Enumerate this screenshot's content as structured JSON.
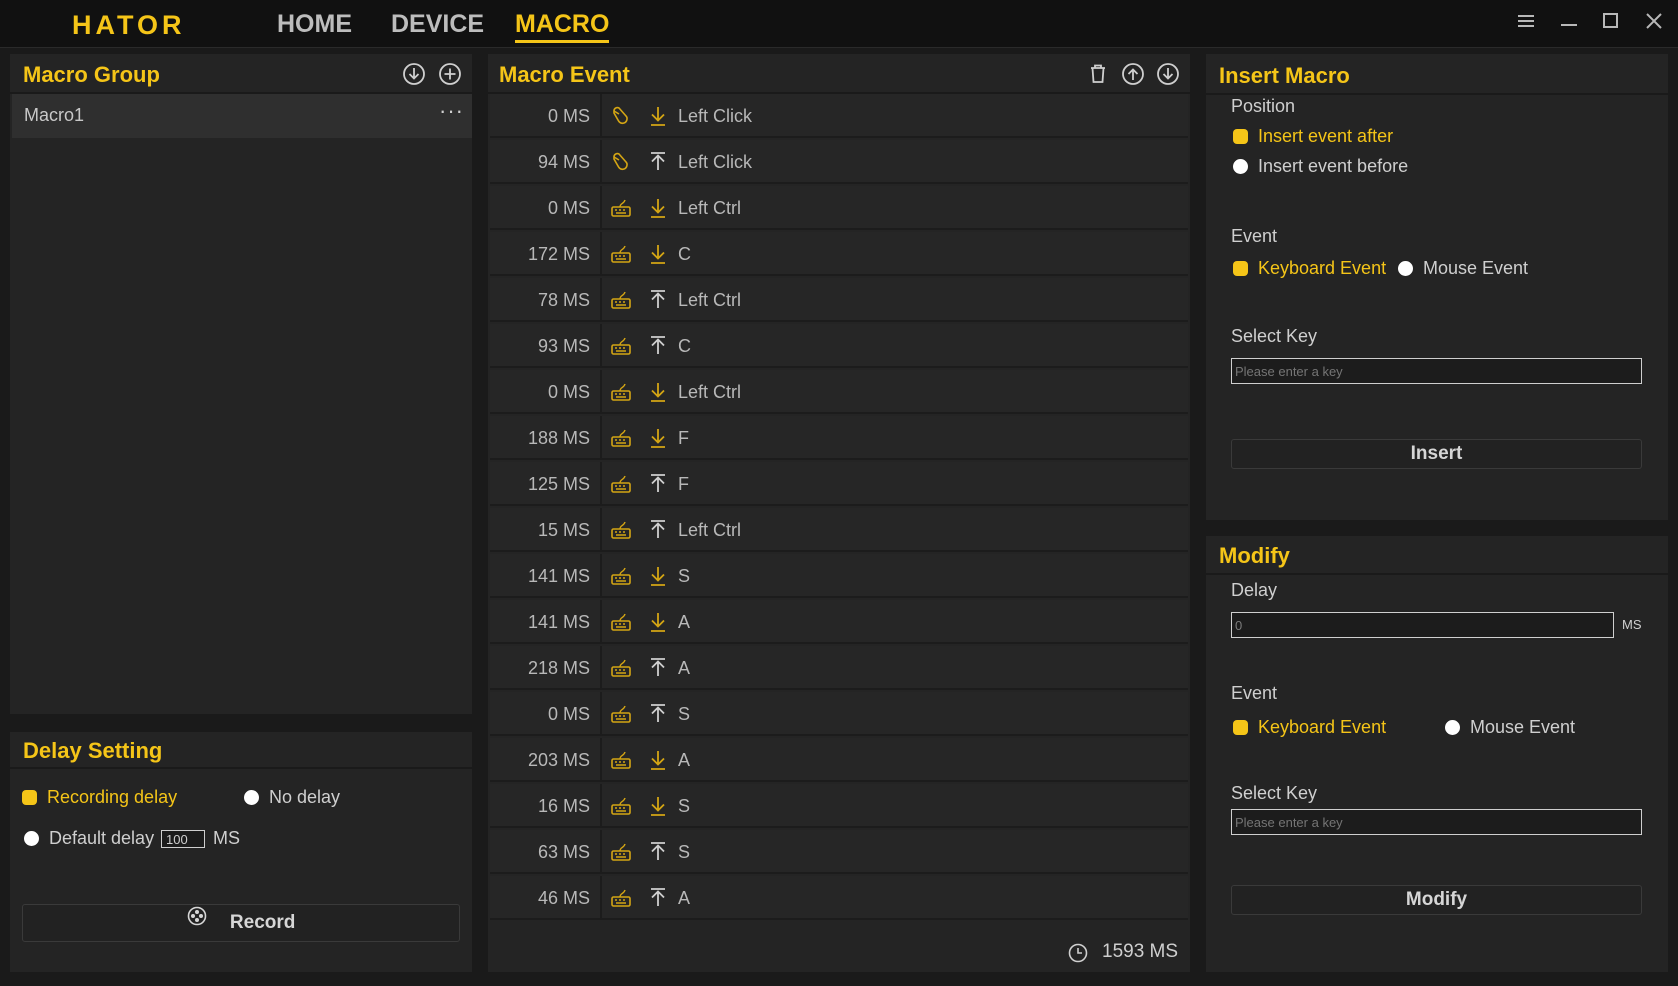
{
  "app": {
    "logo": "HATOR",
    "nav": [
      {
        "label": "HOME"
      },
      {
        "label": "DEVICE"
      },
      {
        "label": "MACRO"
      }
    ]
  },
  "macro_group": {
    "title": "Macro Group",
    "items": [
      {
        "label": "Macro1"
      }
    ]
  },
  "delay_setting": {
    "title": "Delay Setting",
    "recording_delay": "Recording delay",
    "no_delay": "No delay",
    "default_delay": "Default delay",
    "default_value": "100",
    "unit": "MS",
    "selected": "Recording delay",
    "record_label": "Record"
  },
  "macro_event": {
    "title": "Macro Event",
    "events": [
      {
        "delay": "0 MS",
        "type": "mouse",
        "dir": "down",
        "key": "Left Click"
      },
      {
        "delay": "94 MS",
        "type": "mouse",
        "dir": "up",
        "key": "Left Click"
      },
      {
        "delay": "0 MS",
        "type": "keyboard",
        "dir": "down",
        "key": "Left Ctrl"
      },
      {
        "delay": "172 MS",
        "type": "keyboard",
        "dir": "down",
        "key": "C"
      },
      {
        "delay": "78 MS",
        "type": "keyboard",
        "dir": "up",
        "key": "Left Ctrl"
      },
      {
        "delay": "93 MS",
        "type": "keyboard",
        "dir": "up",
        "key": "C"
      },
      {
        "delay": "0 MS",
        "type": "keyboard",
        "dir": "down",
        "key": "Left Ctrl"
      },
      {
        "delay": "188 MS",
        "type": "keyboard",
        "dir": "down",
        "key": "F"
      },
      {
        "delay": "125 MS",
        "type": "keyboard",
        "dir": "up",
        "key": "F"
      },
      {
        "delay": "15 MS",
        "type": "keyboard",
        "dir": "up",
        "key": "Left Ctrl"
      },
      {
        "delay": "141 MS",
        "type": "keyboard",
        "dir": "down",
        "key": "S"
      },
      {
        "delay": "141 MS",
        "type": "keyboard",
        "dir": "down",
        "key": "A"
      },
      {
        "delay": "218 MS",
        "type": "keyboard",
        "dir": "up",
        "key": "A"
      },
      {
        "delay": "0 MS",
        "type": "keyboard",
        "dir": "up",
        "key": "S"
      },
      {
        "delay": "203 MS",
        "type": "keyboard",
        "dir": "down",
        "key": "A"
      },
      {
        "delay": "16 MS",
        "type": "keyboard",
        "dir": "down",
        "key": "S"
      },
      {
        "delay": "63 MS",
        "type": "keyboard",
        "dir": "up",
        "key": "S"
      },
      {
        "delay": "46 MS",
        "type": "keyboard",
        "dir": "up",
        "key": "A"
      }
    ],
    "total": "1593 MS"
  },
  "insert_macro": {
    "title": "Insert Macro",
    "position_label": "Position",
    "insert_after": "Insert event after",
    "insert_before": "Insert event before",
    "position_selected": "Insert event after",
    "event_label": "Event",
    "keyboard_event": "Keyboard Event",
    "mouse_event": "Mouse Event",
    "event_selected": "Keyboard Event",
    "select_key_label": "Select Key",
    "select_key_placeholder": "Please enter a key",
    "insert_button": "Insert"
  },
  "modify": {
    "title": "Modify",
    "delay_label": "Delay",
    "delay_value": "0",
    "unit": "MS",
    "event_label": "Event",
    "keyboard_event": "Keyboard Event",
    "mouse_event": "Mouse Event",
    "event_selected": "Keyboard Event",
    "select_key_label": "Select Key",
    "select_key_placeholder": "Please enter a key",
    "modify_button": "Modify"
  },
  "colors": {
    "accent": "#f5c518",
    "background": "#1a1a1a",
    "panel": "#242424",
    "text": "#c8c8c8"
  }
}
